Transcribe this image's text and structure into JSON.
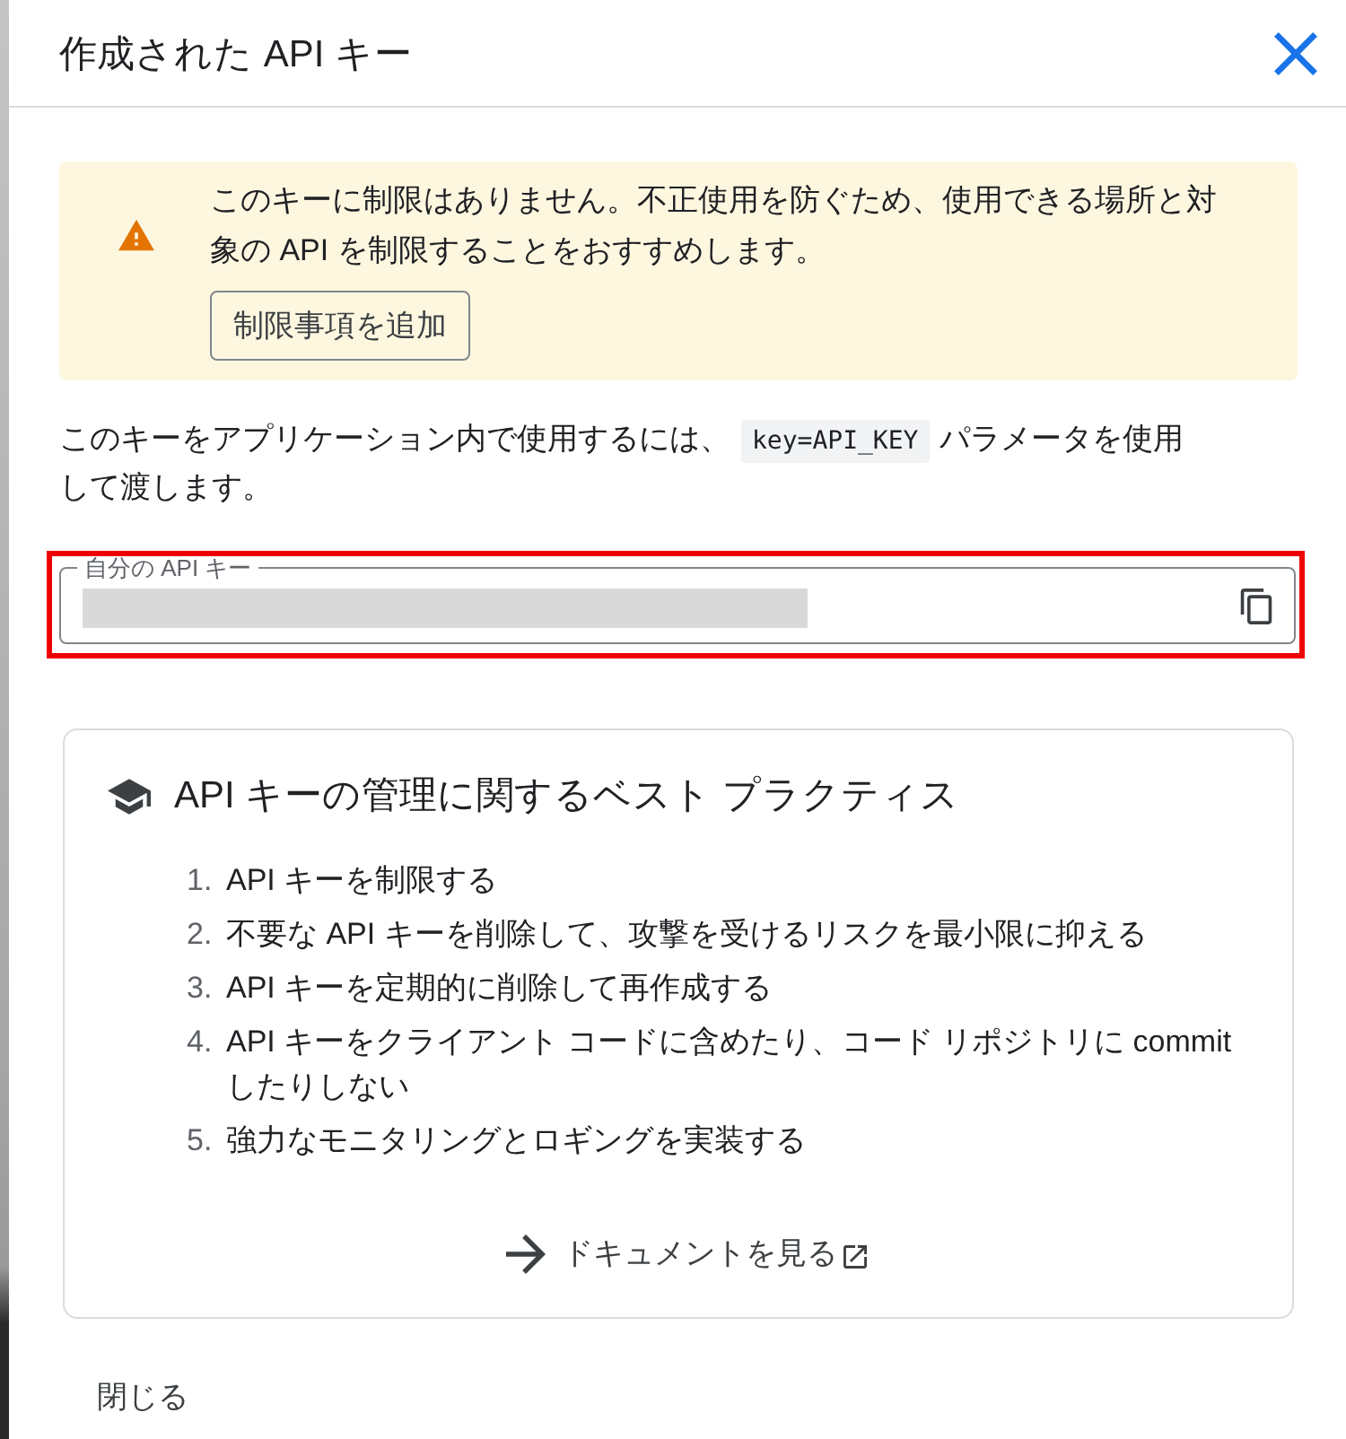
{
  "dialog": {
    "title": "作成された API キー"
  },
  "warning": {
    "message": "このキーに制限はありません。不正使用を防ぐため、使用できる場所と対象の API を制限することをおすすめします。",
    "button": "制限事項を追加"
  },
  "usage_note": {
    "before": "このキーをアプリケーション内で使用するには、",
    "code": "key=API_KEY",
    "after": "パラメータを使用して渡します。"
  },
  "key_field": {
    "label": "自分の API キー",
    "highlighted": true
  },
  "best_practices": {
    "title": "API キーの管理に関するベスト プラクティス",
    "items": [
      {
        "number": "1.",
        "text": "API キーを制限する"
      },
      {
        "number": "2.",
        "text": "不要な API キーを削除して、攻撃を受けるリスクを最小限に抑える"
      },
      {
        "number": "3.",
        "text": "API キーを定期的に削除して再作成する"
      },
      {
        "number": "4.",
        "text": "API キーをクライアント コードに含めたり、コード リポジトリに commit したりしない"
      },
      {
        "number": "5.",
        "text": "強力なモニタリングとロギングを実装する"
      }
    ],
    "link": "ドキュメントを見る"
  },
  "footer": {
    "close_button": "閉じる"
  }
}
